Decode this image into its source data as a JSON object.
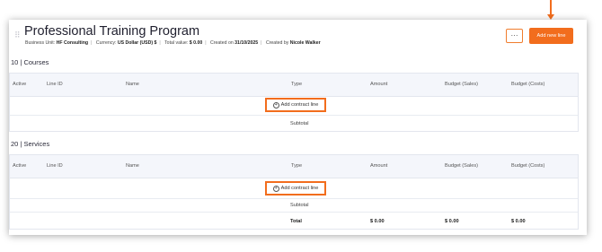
{
  "header": {
    "title": "Professional Training Program",
    "meta": {
      "business_unit_label": "Business Unit:",
      "business_unit_value": "HF Consulting",
      "currency_label": "Currency:",
      "currency_value": "US Dollar (USD) $",
      "total_value_label": "Total value:",
      "total_value_value": "$ 0.00",
      "created_on_label": "Created on",
      "created_on_value": "31/10/2025",
      "created_by_label": "Created by",
      "created_by_value": "Nicole Walker"
    },
    "menu_label": "···",
    "add_new_line_label": "Add new line"
  },
  "columns": [
    "Active",
    "Line ID",
    "Name",
    "Type",
    "Amount",
    "Budget (Sales)",
    "Budget (Costs)"
  ],
  "sections": [
    {
      "title": "10 | Courses",
      "add_contract_line_label": "Add contract line",
      "subtotal_label": "Subtotal"
    },
    {
      "title": "20 | Services",
      "add_contract_line_label": "Add contract line",
      "subtotal_label": "Subtotal"
    }
  ],
  "totals": {
    "label": "Total",
    "amount": "$ 0.00",
    "budget_sales": "$ 0.00",
    "budget_costs": "$ 0.00"
  },
  "colors": {
    "accent": "#f26d1d"
  }
}
